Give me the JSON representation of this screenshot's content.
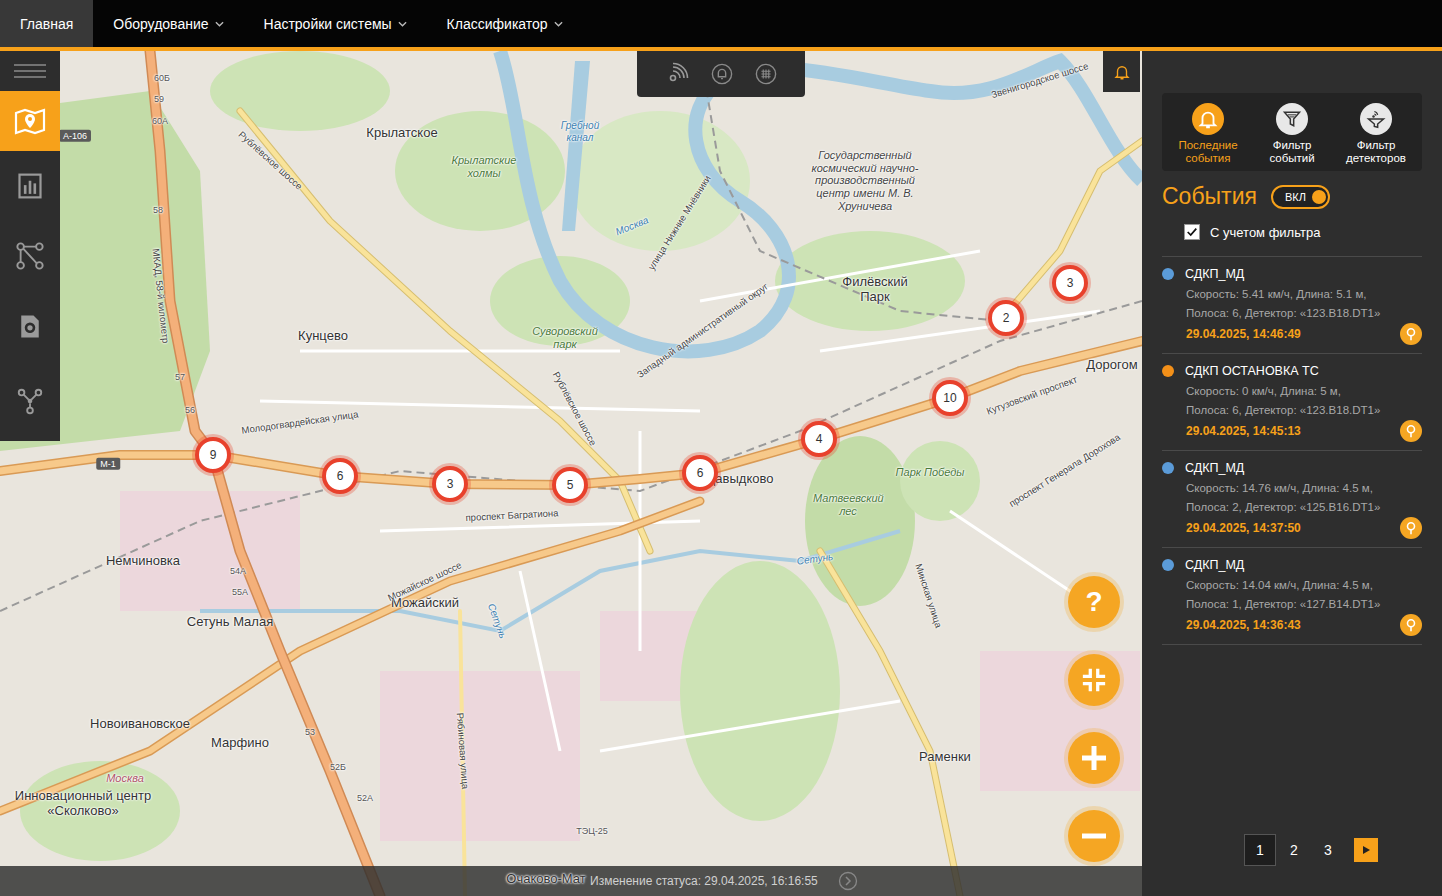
{
  "nav": {
    "tabs": [
      {
        "label": "Главная",
        "selected": true,
        "dropdown": false
      },
      {
        "label": "Оборудование",
        "selected": false,
        "dropdown": true
      },
      {
        "label": "Настройки системы",
        "selected": false,
        "dropdown": true
      },
      {
        "label": "Классификатор",
        "selected": false,
        "dropdown": true
      }
    ]
  },
  "sidebar": {
    "items": [
      {
        "selected": true
      },
      {
        "selected": false
      },
      {
        "selected": false
      },
      {
        "selected": false
      },
      {
        "selected": false
      }
    ]
  },
  "map": {
    "labels": [
      "Крылатское",
      "Гребной канал",
      "Крылатские холмы",
      "Кунцево",
      "Суворовский парк",
      "Государственный космический научно-производственный центр имени М. В. Хруничева",
      "Филёвский Парк",
      "Дорогом",
      "Давыдково",
      "Матвеевский лес",
      "Парк Победы",
      "Немчиновка",
      "Можайский",
      "Сетунь Малая",
      "Новоивановское",
      "Марфино",
      "Москва",
      "Инновационный центр «Сколково»",
      "Раменки",
      "Рублёвское шоссе",
      "Рублёвское шоссе",
      "Молодогвардейская улица",
      "проспект Багратиона",
      "Кутузовский проспект",
      "Можайское шоссе",
      "Минская улица",
      "проспект Генерала Дорохова",
      "Рябиновая улица",
      "улица Нижние Мнёвники",
      "Западный административный округ",
      "МКАД, 58-й километр",
      "Звенигородское шоссе",
      "ТЭЦ-25",
      "М-1",
      "А-106",
      "Москва",
      "Сетунь",
      "Сетунь",
      "60Б",
      "59",
      "60А",
      "58",
      "57",
      "56",
      "54А",
      "55А",
      "53",
      "52Б",
      "52А",
      "Очаково-Мат"
    ],
    "markers": [
      {
        "count": "9"
      },
      {
        "count": "6"
      },
      {
        "count": "3"
      },
      {
        "count": "5"
      },
      {
        "count": "6"
      },
      {
        "count": "4"
      },
      {
        "count": "10"
      },
      {
        "count": "2"
      },
      {
        "count": "3"
      }
    ]
  },
  "map_controls": {
    "help": "?"
  },
  "status_bar": {
    "text": "Изменение статуса: 29.04.2025, 16:16:55"
  },
  "events_panel": {
    "tools": [
      {
        "label": "Последние события",
        "selected": true
      },
      {
        "label": "Фильтр событий",
        "selected": false
      },
      {
        "label": "Фильтр детекторов",
        "selected": false
      }
    ],
    "title": "События",
    "toggle": {
      "label": "ВКЛ",
      "on": true
    },
    "filter": {
      "label": "С учетом фильтра",
      "checked": true
    },
    "events": [
      {
        "title": "СДКП_МД",
        "color": "#5b9bd8",
        "details": [
          "Скорость: 5.41 км/ч, Длина: 5.1 м,",
          "Полоса: 6, Детектор: «123.B18.DT1»"
        ],
        "time": "29.04.2025, 14:46:49"
      },
      {
        "title": "СДКП ОСТАНОВКА ТС",
        "color": "#f39019",
        "details": [
          "Скорость: 0 км/ч, Длина: 5 м,",
          "Полоса: 6, Детектор: «123.B18.DT1»"
        ],
        "time": "29.04.2025, 14:45:13"
      },
      {
        "title": "СДКП_МД",
        "color": "#5b9bd8",
        "details": [
          "Скорость: 14.76 км/ч, Длина: 4.5 м,",
          "Полоса: 2, Детектор: «125.B16.DT1»"
        ],
        "time": "29.04.2025, 14:37:50"
      },
      {
        "title": "СДКП_МД",
        "color": "#5b9bd8",
        "details": [
          "Скорость: 14.04 км/ч, Длина: 4.5 м,",
          "Полоса: 1, Детектор: «127.B14.DT1»"
        ],
        "time": "29.04.2025, 14:36:43"
      }
    ],
    "pagination": {
      "pages": [
        {
          "label": "1",
          "selected": true
        },
        {
          "label": "2",
          "selected": false
        },
        {
          "label": "3",
          "selected": false
        }
      ]
    }
  }
}
